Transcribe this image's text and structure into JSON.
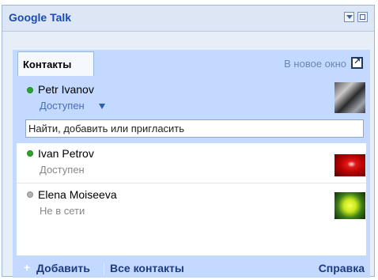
{
  "app": {
    "title": "Google Talk"
  },
  "tabs": {
    "contacts": "Контакты"
  },
  "header": {
    "new_window": "В новое окно"
  },
  "me": {
    "name": "Petr Ivanov",
    "status": "Доступен",
    "presence": "online"
  },
  "search": {
    "placeholder": "Найти, добавить или пригласить"
  },
  "contacts": [
    {
      "name": "Ivan Petrov",
      "status": "Доступен",
      "presence": "online"
    },
    {
      "name": "Elena Moiseeva",
      "status": "Не в сети",
      "presence": "offline"
    }
  ],
  "footer": {
    "add": "Добавить",
    "all_contacts": "Все контакты",
    "help": "Справка"
  },
  "colors": {
    "online": "#2aa62a",
    "offline": "#b3b3b3",
    "accent": "#1c4bb5",
    "panel": "#c3d9ff"
  }
}
